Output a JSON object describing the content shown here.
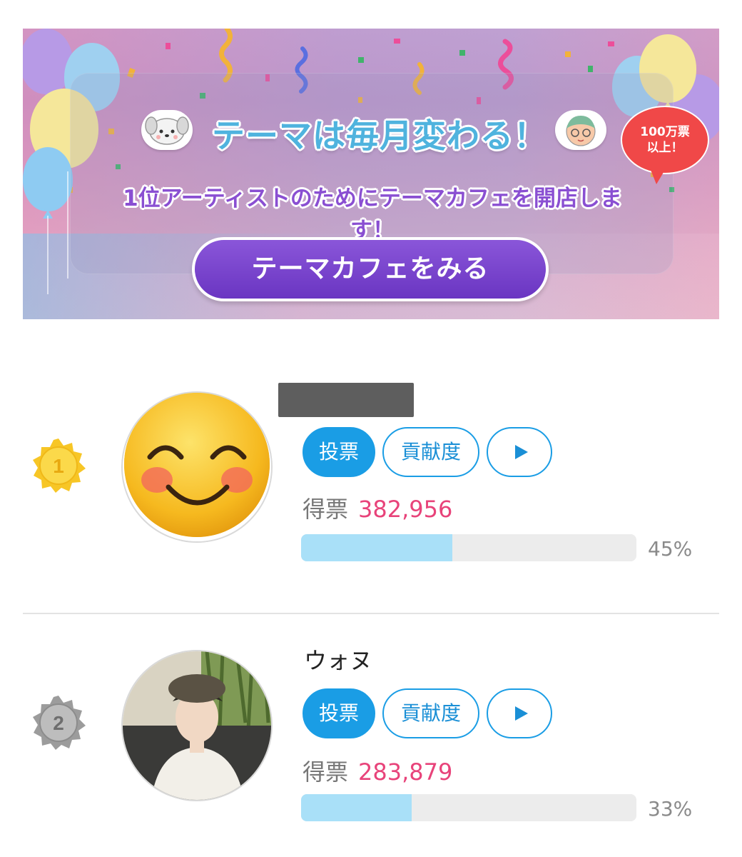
{
  "banner": {
    "title": "テーマは毎月変わる！",
    "subtitle": "1位アーティストのためにテーマカフェを開店します！",
    "cta_label": "テーマカフェをみる",
    "bubble_text": "100万票\n以上！"
  },
  "ranking": {
    "vote_label": "投票",
    "contribution_label": "貢献度",
    "votes_label": "得票",
    "entries": [
      {
        "rank": "1",
        "name": "",
        "votes": "382,956",
        "percent_text": "45%",
        "percent": 45,
        "medal": "gold-medal-icon"
      },
      {
        "rank": "2",
        "name": "ウォヌ",
        "votes": "283,879",
        "percent_text": "33%",
        "percent": 33,
        "medal": "silver-medal-icon"
      }
    ]
  },
  "colors": {
    "accent_blue": "#1a9de5",
    "vote_pink": "#e8437a",
    "bar_fill": "#a9e0f8",
    "cta_purple": "#7440c9"
  }
}
